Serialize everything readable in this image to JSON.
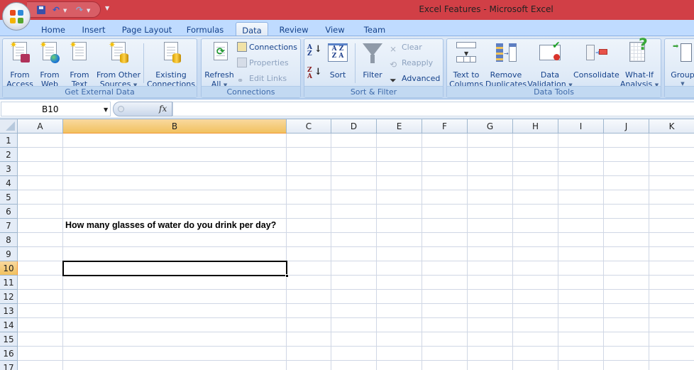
{
  "window": {
    "title": "Excel Features - Microsoft Excel",
    "office_button": "office-button"
  },
  "quick_access": {
    "items": [
      "save",
      "undo",
      "redo",
      "customize"
    ]
  },
  "tabs": [
    {
      "label": "Home",
      "active": false
    },
    {
      "label": "Insert",
      "active": false
    },
    {
      "label": "Page Layout",
      "active": false
    },
    {
      "label": "Formulas",
      "active": false
    },
    {
      "label": "Data",
      "active": true
    },
    {
      "label": "Review",
      "active": false
    },
    {
      "label": "View",
      "active": false
    },
    {
      "label": "Team",
      "active": false
    }
  ],
  "ribbon": {
    "get_external_data": {
      "label": "Get External Data",
      "from_access": [
        "From",
        "Access"
      ],
      "from_web": [
        "From",
        "Web"
      ],
      "from_text": [
        "From",
        "Text"
      ],
      "from_other_sources": [
        "From Other",
        "Sources"
      ],
      "existing_connections": [
        "Existing",
        "Connections"
      ]
    },
    "connections": {
      "label": "Connections",
      "refresh_all": [
        "Refresh",
        "All"
      ],
      "connections": "Connections",
      "properties": "Properties",
      "edit_links": "Edit Links"
    },
    "sort_filter": {
      "label": "Sort & Filter",
      "sort": "Sort",
      "filter": "Filter",
      "clear": "Clear",
      "reapply": "Reapply",
      "advanced": "Advanced"
    },
    "data_tools": {
      "label": "Data Tools",
      "text_to_columns": [
        "Text to",
        "Columns"
      ],
      "remove_duplicates": [
        "Remove",
        "Duplicates"
      ],
      "data_validation": [
        "Data",
        "Validation"
      ],
      "consolidate": "Consolidate",
      "what_if": [
        "What-If",
        "Analysis"
      ]
    },
    "outline": {
      "group": "Group"
    }
  },
  "formula_bar": {
    "name_box": "B10",
    "fx_label": "fx",
    "formula": ""
  },
  "sheet": {
    "columns": [
      "A",
      "B",
      "C",
      "D",
      "E",
      "F",
      "G",
      "H",
      "I",
      "J",
      "K"
    ],
    "selected_column": "B",
    "rows": [
      "1",
      "2",
      "3",
      "4",
      "5",
      "6",
      "7",
      "8",
      "9",
      "10",
      "11",
      "12",
      "13",
      "14",
      "15",
      "16",
      "17"
    ],
    "selected_row": "10",
    "cells": {
      "B7": "How many glasses of water do you drink per day?"
    },
    "active_cell": "B10"
  }
}
